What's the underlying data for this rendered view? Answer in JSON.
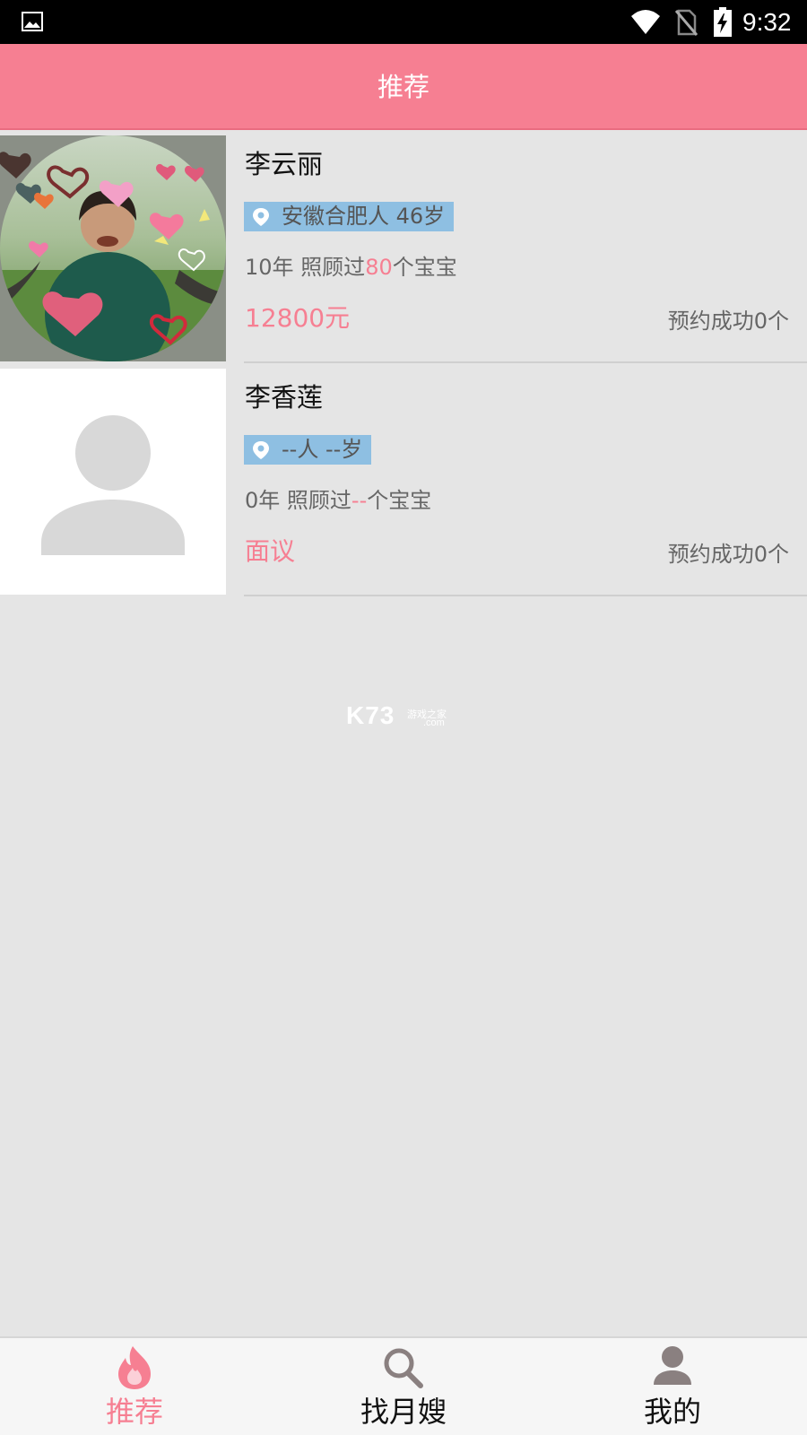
{
  "status_bar": {
    "time": "9:32",
    "icons": [
      "gallery-icon",
      "wifi-icon",
      "no-sim-icon",
      "battery-charging-icon"
    ]
  },
  "header": {
    "title": "推荐"
  },
  "nannies": [
    {
      "name": "李云丽",
      "location": "安徽合肥人 46岁",
      "years": "10年",
      "cared_prefix": "照顾过",
      "cared_count": "80",
      "cared_suffix": "个宝宝",
      "price": "12800元",
      "booked": "预约成功0个",
      "photo": "portrait-photo"
    },
    {
      "name": "李香莲",
      "location": "--人 --岁",
      "years": "0年",
      "cared_prefix": "照顾过",
      "cared_count": "--",
      "cared_suffix": "个宝宝",
      "price": "面议",
      "booked": "预约成功0个",
      "photo": "default-avatar"
    }
  ],
  "watermark": {
    "brand": "K73",
    "cn": "游戏之家",
    "domain": ".com"
  },
  "tabs": [
    {
      "label": "推荐",
      "icon": "flame-icon",
      "active": true
    },
    {
      "label": "找月嫂",
      "icon": "search-icon",
      "active": false
    },
    {
      "label": "我的",
      "icon": "person-icon",
      "active": false
    }
  ],
  "colors": {
    "accent": "#f67f92",
    "location_bg": "#8ebfe2",
    "background": "#e5e5e5"
  }
}
